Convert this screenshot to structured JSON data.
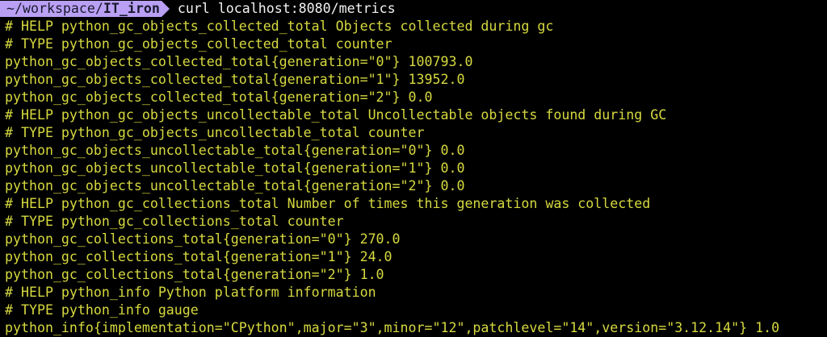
{
  "prompt": {
    "path_prefix": "~/workspace/",
    "path_current": "IT_iron",
    "command": "curl localhost:8080/metrics"
  },
  "output": [
    "# HELP python_gc_objects_collected_total Objects collected during gc",
    "# TYPE python_gc_objects_collected_total counter",
    "python_gc_objects_collected_total{generation=\"0\"} 100793.0",
    "python_gc_objects_collected_total{generation=\"1\"} 13952.0",
    "python_gc_objects_collected_total{generation=\"2\"} 0.0",
    "# HELP python_gc_objects_uncollectable_total Uncollectable objects found during GC",
    "# TYPE python_gc_objects_uncollectable_total counter",
    "python_gc_objects_uncollectable_total{generation=\"0\"} 0.0",
    "python_gc_objects_uncollectable_total{generation=\"1\"} 0.0",
    "python_gc_objects_uncollectable_total{generation=\"2\"} 0.0",
    "# HELP python_gc_collections_total Number of times this generation was collected",
    "# TYPE python_gc_collections_total counter",
    "python_gc_collections_total{generation=\"0\"} 270.0",
    "python_gc_collections_total{generation=\"1\"} 24.0",
    "python_gc_collections_total{generation=\"2\"} 1.0",
    "# HELP python_info Python platform information",
    "# TYPE python_info gauge",
    "python_info{implementation=\"CPython\",major=\"3\",minor=\"12\",patchlevel=\"14\",version=\"3.12.14\"} 1.0"
  ],
  "colors": {
    "background": "#000000",
    "output_text": "#d6d93f",
    "prompt_badge": "#b9a0f4",
    "command_text": "#f2f2f2"
  }
}
